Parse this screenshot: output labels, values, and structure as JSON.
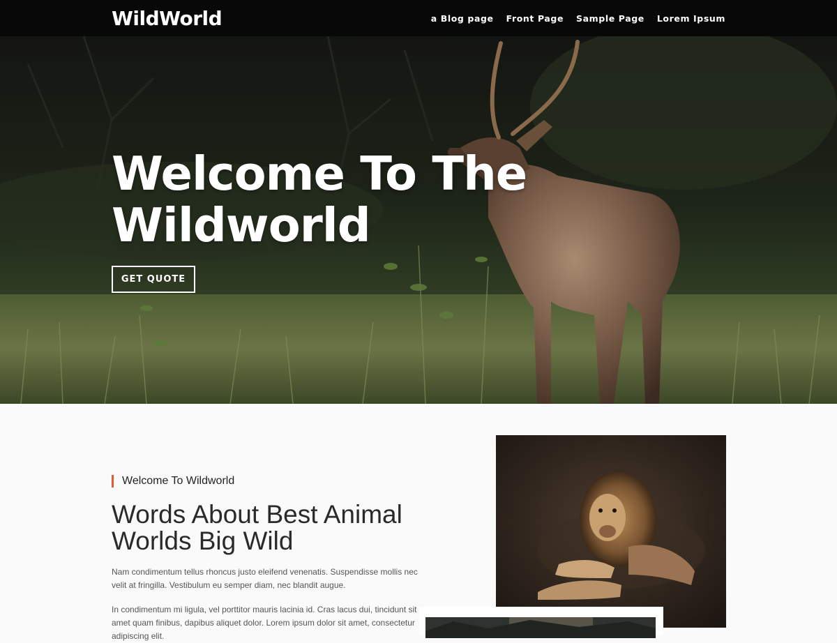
{
  "site": {
    "logo": "WildWorld",
    "nav": [
      "a Blog page",
      "Front Page",
      "Sample Page",
      "Lorem Ipsum"
    ]
  },
  "hero": {
    "title": "Welcome To The Wildworld",
    "button_label": "GET QUOTE",
    "image": "elk-in-meadow"
  },
  "about": {
    "eyebrow": "Welcome To Wildworld",
    "heading": "Words About Best Animal Worlds Big Wild",
    "paragraphs": [
      "Nam condimentum tellus rhoncus justo eleifend venenatis. Suspendisse mollis nec velit at fringilla. Vestibulum eu semper diam, nec blandit augue.",
      "In condimentum mi ligula, vel porttitor mauris lacinia id. Cras lacus dui, tincidunt sit amet quam finibus, dapibus aliquet dolor. Lorem ipsum dolor sit amet, consectetur adipiscing elit."
    ],
    "images": [
      "lion-lying",
      "forest-photo"
    ]
  },
  "colors": {
    "topbar": "#080808",
    "accent": "#e05a33",
    "text_dark": "#2a2a2a",
    "text_body": "#555555"
  }
}
